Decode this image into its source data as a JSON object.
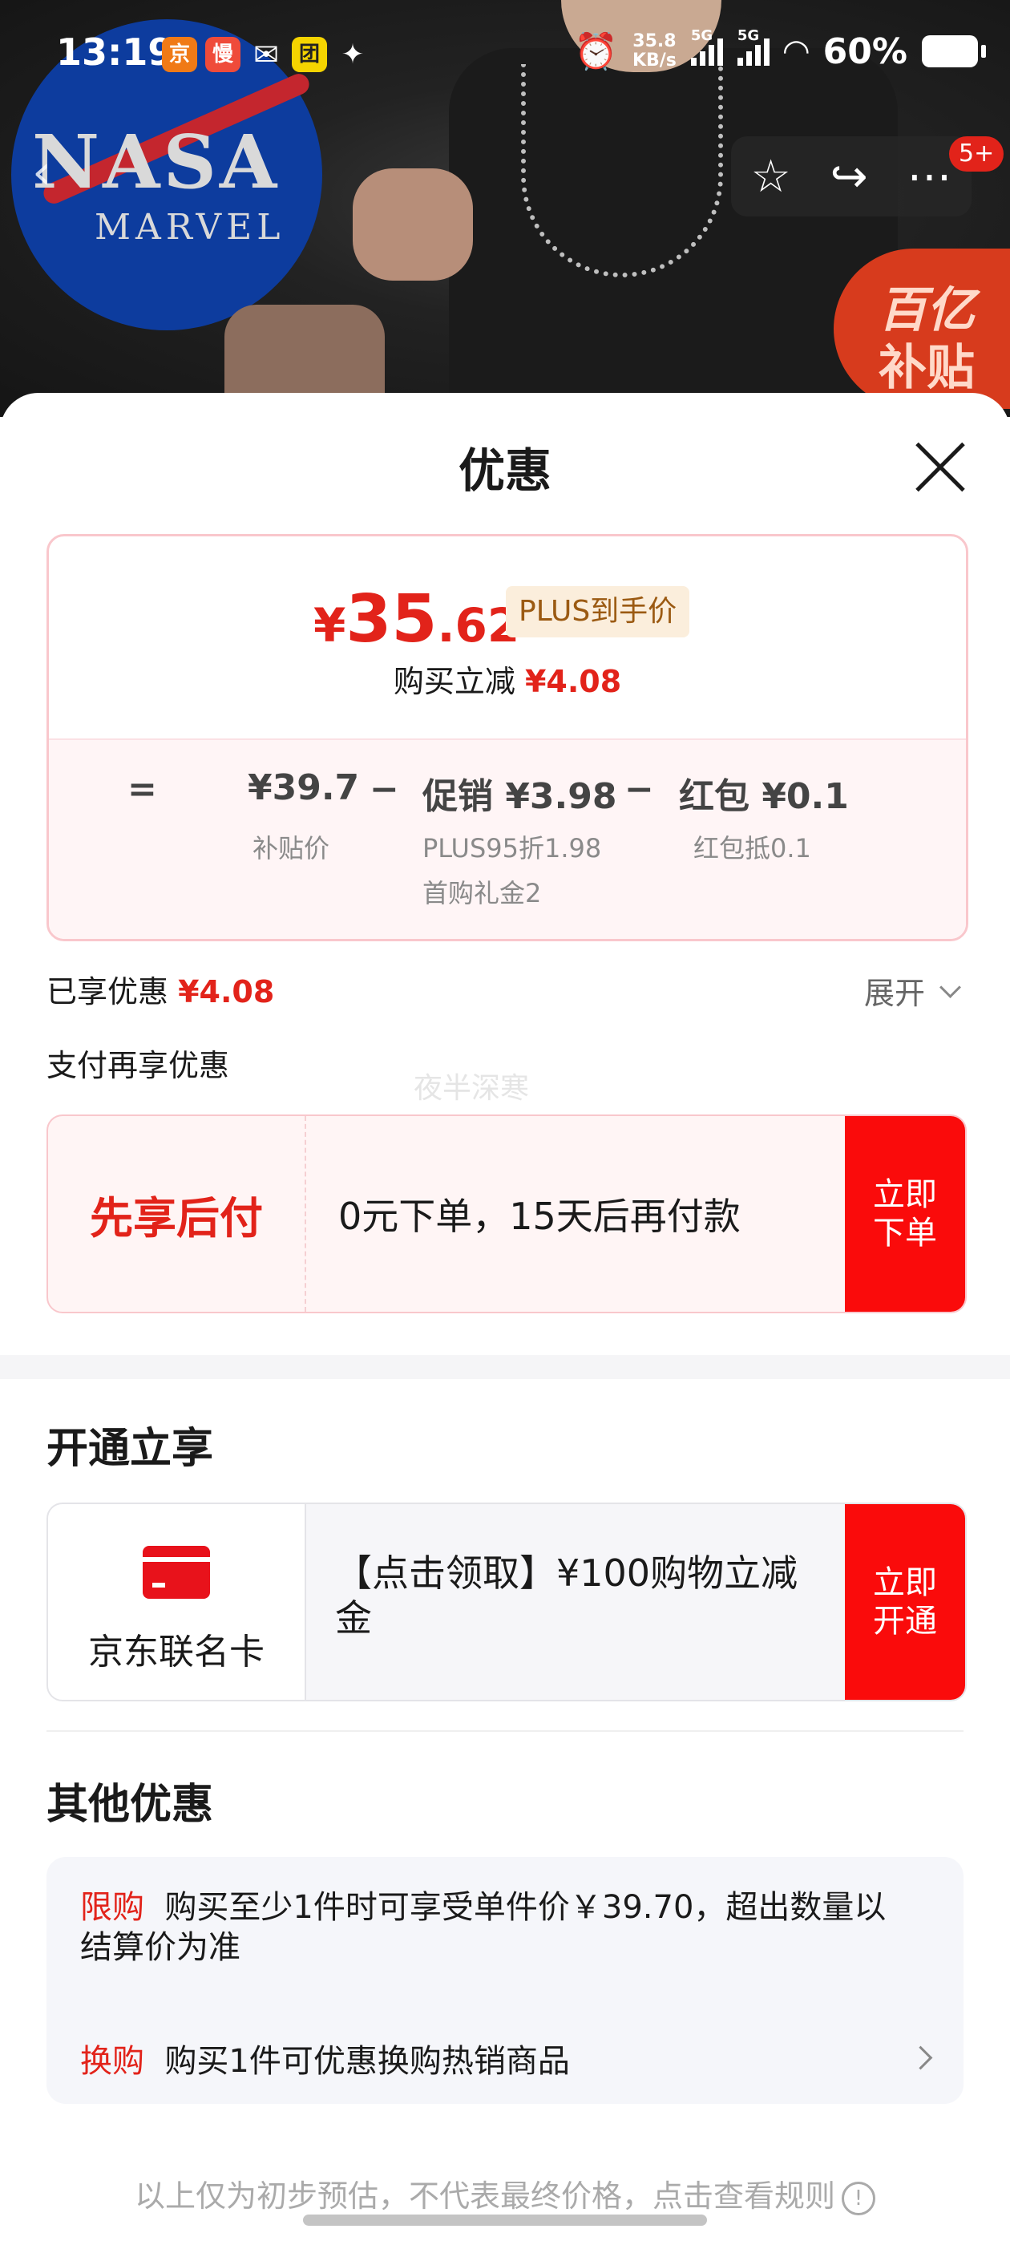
{
  "status_bar": {
    "time": "13:19",
    "net_speed_value": "35.8",
    "net_speed_unit": "KB/s",
    "sim1": "5G",
    "sim2": "5G",
    "battery": "60%",
    "app_icons": [
      "jd-app-icon",
      "slow-app-icon",
      "wechat-icon",
      "meituan-icon",
      "pinduoduo-icon"
    ]
  },
  "hero": {
    "logo_text": "NASA",
    "logo_sub": "MARVEL",
    "cart_badge": "5+",
    "subsidy_line1": "百亿",
    "subsidy_line2": "补贴"
  },
  "sheet": {
    "title": "优惠",
    "price": {
      "currency": "¥",
      "integer": "35",
      "decimal": ".62",
      "tag": "PLUS到手价",
      "reduce_label": "购买立减",
      "reduce_amount": "¥4.08"
    },
    "breakdown": {
      "equals": "=",
      "minus": "−",
      "subsidy_price": "¥39.7",
      "subsidy_label": "补贴价",
      "promo_value": "促销 ¥3.98",
      "promo_detail1": "PLUS95折1.98",
      "promo_detail2": "首购礼金2",
      "redpacket_value": "红包 ¥0.1",
      "redpacket_detail": "红包抵0.1"
    },
    "enjoyed_label": "已享优惠",
    "enjoyed_amount": "¥4.08",
    "expand_label": "展开",
    "pay_more_label": "支付再享优惠",
    "watermark": "夜半深寒",
    "pay_later": {
      "title": "先享后付",
      "desc": "0元下单，15天后再付款",
      "cta": "立即下单"
    },
    "open_section_title": "开通立享",
    "co_brand": {
      "name": "京东联名卡",
      "desc": "【点击领取】¥100购物立减金",
      "cta": "立即开通"
    },
    "other_title": "其他优惠",
    "other": [
      {
        "tag": "限购",
        "text": "购买至少1件时可享受单件价￥39.70，超出数量以结算价为准"
      },
      {
        "tag": "换购",
        "text": "购买1件可优惠换购热销商品"
      }
    ],
    "footnote": "以上仅为初步预估，不代表最终价格，点击查看规则",
    "info_glyph": "!"
  },
  "colors": {
    "accent_red": "#e2231a",
    "cta_red": "#fa0b0b",
    "plus_tag_bg": "#fbeedc",
    "plus_tag_text": "#9b5a12"
  }
}
